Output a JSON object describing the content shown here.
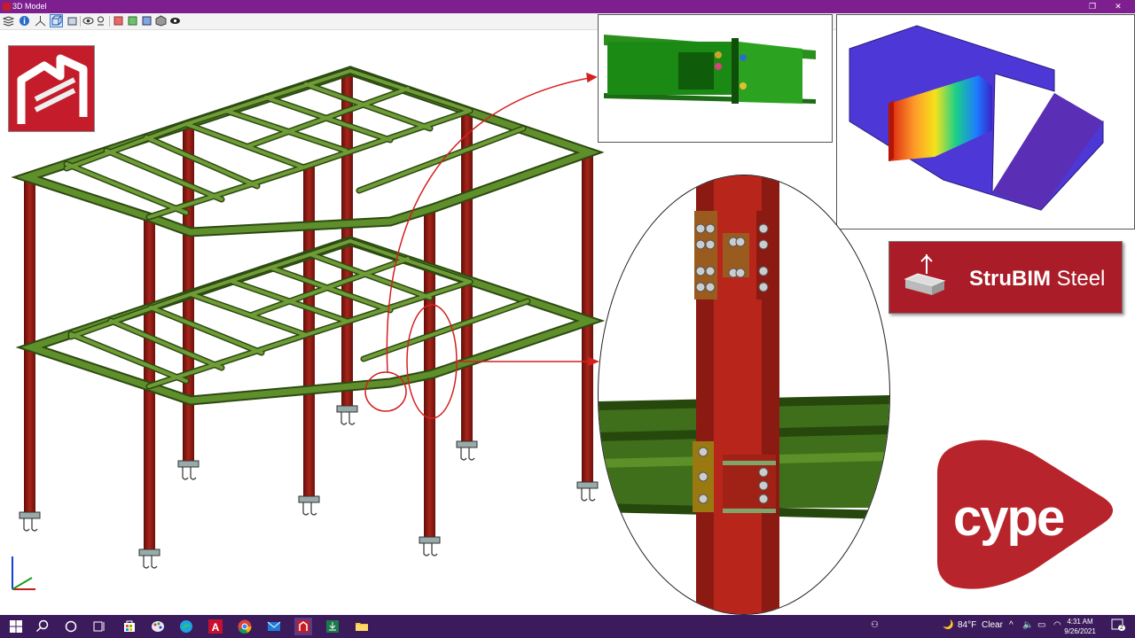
{
  "window": {
    "title": "3D Model",
    "icon": "cype-app-icon",
    "restore_icon": "restore-icon",
    "close_icon": "close-icon"
  },
  "toolbar": {
    "items": [
      "layers-icon",
      "info-icon",
      "axes-icon",
      "view-3d-icon",
      "box-icon",
      "eye-icon",
      "light-icon",
      "red-grid-icon",
      "green-grid-icon",
      "blue-grid-icon",
      "cube-icon",
      "visibility-icon"
    ]
  },
  "brand": {
    "strubim_line1": "StruBIM",
    "strubim_line2": "Steel",
    "cype_text": "cype",
    "accent": "#aa1c28",
    "beam_color": "#4e7a23",
    "column_color": "#8e1a14"
  },
  "taskbar": {
    "apps": [
      "windows-start-icon",
      "search-icon",
      "cortana-icon",
      "task-view-icon",
      "store-icon",
      "paint-icon",
      "edge-icon",
      "autocad-icon",
      "chrome-icon",
      "mail-icon",
      "cype-taskbar-icon",
      "download-icon",
      "file-explorer-icon"
    ],
    "weather_temp": "84°F",
    "weather_text": "Clear",
    "time": "4:31 AM",
    "date": "9/26/2021",
    "notification_count": "2"
  }
}
